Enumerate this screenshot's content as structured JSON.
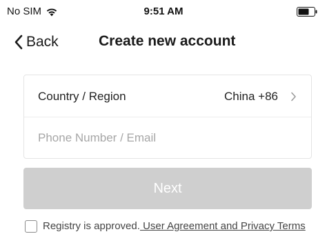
{
  "status_bar": {
    "carrier": "No SIM",
    "time": "9:51 AM",
    "icons": [
      "wifi-icon",
      "battery-icon"
    ]
  },
  "nav": {
    "back_label": "Back",
    "title": "Create new account",
    "back_icon": "chevron-left-icon"
  },
  "form": {
    "country_label": "Country / Region",
    "country_value": "China +86",
    "country_icon": "chevron-right-icon",
    "phone_placeholder": "Phone Number / Email",
    "phone_value": ""
  },
  "next_label": "Next",
  "agreement": {
    "checked": false,
    "prefix": "Registry is approved.",
    "link_text": " User Agreement and Privacy Terms"
  },
  "colors": {
    "next_button_disabled": "#cfcfcf",
    "placeholder": "#a6a6a6"
  }
}
